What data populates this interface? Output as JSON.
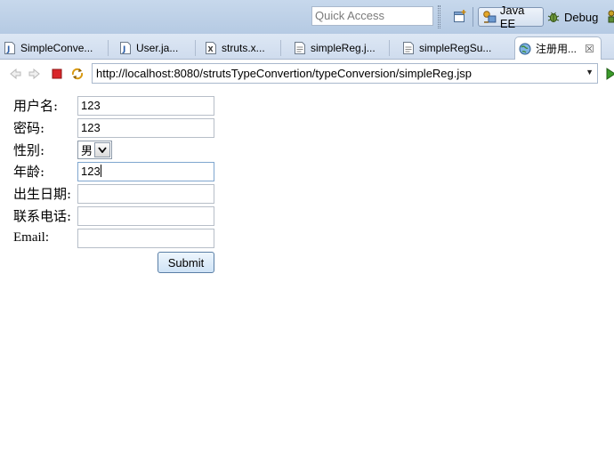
{
  "toolbar": {
    "quick_access_placeholder": "Quick Access",
    "perspective_javaee_label": "Java EE",
    "perspective_debug_label": "Debug"
  },
  "tabs": [
    {
      "label": "SimpleConve...",
      "icon": "java-file-icon"
    },
    {
      "label": "User.ja...",
      "icon": "java-file-icon"
    },
    {
      "label": "struts.x...",
      "icon": "xml-file-icon"
    },
    {
      "label": "simpleReg.j...",
      "icon": "jsp-file-icon"
    },
    {
      "label": "simpleRegSu...",
      "icon": "jsp-file-icon"
    },
    {
      "label": "注册用...",
      "icon": "globe-icon",
      "active": true
    }
  ],
  "browser": {
    "url": "http://localhost:8080/strutsTypeConvertion/typeConversion/simpleReg.jsp"
  },
  "form": {
    "username_label": "用户名:",
    "username_value": "123",
    "password_label": "密码:",
    "password_value": "123",
    "gender_label": "性别:",
    "gender_value": "男",
    "age_label": "年龄:",
    "age_value": "123",
    "birthday_label": "出生日期:",
    "birthday_value": "",
    "phone_label": "联系电话:",
    "phone_value": "",
    "email_label": "Email:",
    "email_value": "",
    "submit_label": "Submit"
  },
  "colors": {
    "toolbar_bg": "#b5cae3",
    "tab_bg": "#cfdcee",
    "stop_red": "#d9262a"
  }
}
